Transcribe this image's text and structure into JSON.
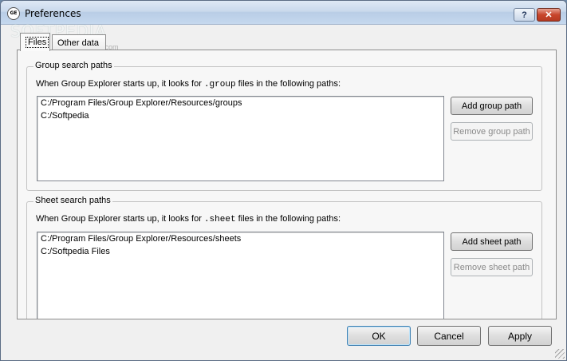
{
  "window": {
    "title": "Preferences",
    "help_label": "?",
    "close_label": "✕",
    "watermark": "SOFTPEDIA",
    "watermark_sub": "www.softpedia.com"
  },
  "tabs": [
    {
      "label": "Files",
      "active": true
    },
    {
      "label": "Other data",
      "active": false
    }
  ],
  "group_paths": {
    "legend": "Group search paths",
    "desc_prefix": "When Group Explorer starts up, it looks for",
    "desc_ext": ".group",
    "desc_suffix": "files in the following paths:",
    "items": [
      "C:/Program Files/Group Explorer/Resources/groups",
      "C:/Softpedia"
    ],
    "add_label": "Add group path",
    "remove_label": "Remove group path"
  },
  "sheet_paths": {
    "legend": "Sheet search paths",
    "desc_prefix": "When Group Explorer starts up, it looks for",
    "desc_ext": ".sheet",
    "desc_suffix": "files in the following paths:",
    "items": [
      "C:/Program Files/Group Explorer/Resources/sheets",
      "C:/Softpedia Files"
    ],
    "add_label": "Add sheet path",
    "remove_label": "Remove sheet path"
  },
  "footer": {
    "ok_label": "OK",
    "cancel_label": "Cancel",
    "apply_label": "Apply"
  }
}
